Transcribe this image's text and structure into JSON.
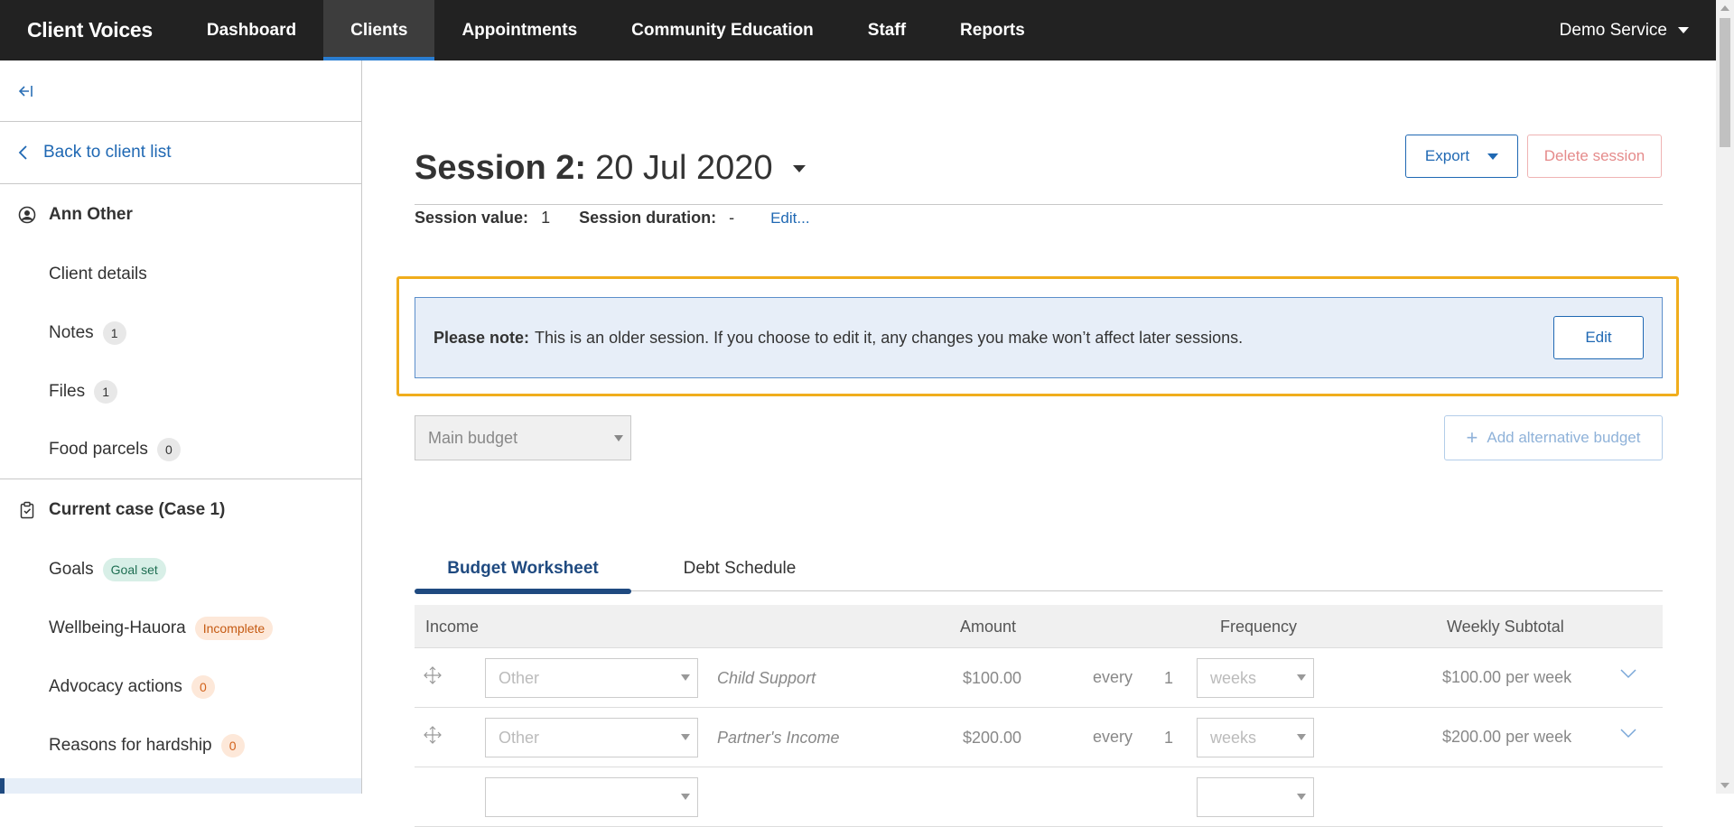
{
  "nav": {
    "brand": "Client Voices",
    "items": [
      {
        "label": "Dashboard"
      },
      {
        "label": "Clients"
      },
      {
        "label": "Appointments"
      },
      {
        "label": "Community Education"
      },
      {
        "label": "Staff"
      },
      {
        "label": "Reports"
      }
    ],
    "active_index": 1,
    "service": "Demo Service"
  },
  "sidebar": {
    "collapse_icon": "collapse-left-icon",
    "back_label": "Back to client list",
    "client_name": "Ann Other",
    "client_items": [
      {
        "label": "Client details"
      },
      {
        "label": "Notes",
        "badge": "1"
      },
      {
        "label": "Files",
        "badge": "1"
      },
      {
        "label": "Food parcels",
        "badge": "0"
      }
    ],
    "case_title": "Current case (Case 1)",
    "case_items": [
      {
        "label": "Goals",
        "badge": "Goal set"
      },
      {
        "label": "Wellbeing-Hauora",
        "badge": "Incomplete"
      },
      {
        "label": "Advocacy actions",
        "badge": "0"
      },
      {
        "label": "Reasons for hardship",
        "badge": "0"
      }
    ]
  },
  "session": {
    "title_bold": "Session 2:",
    "title_date": "20 Jul 2020",
    "export_label": "Export",
    "delete_label": "Delete session",
    "value_label": "Session value:",
    "value": "1",
    "duration_label": "Session duration:",
    "duration": "-",
    "edit_link": "Edit..."
  },
  "note": {
    "prefix": "Please note:",
    "text": "This is an older session. If you choose to edit it, any changes you make won’t affect later sessions.",
    "edit_label": "Edit"
  },
  "budget": {
    "select_value": "Main budget",
    "alt_label": "Add alternative budget"
  },
  "tabs": [
    {
      "label": "Budget Worksheet"
    },
    {
      "label": "Debt Schedule"
    }
  ],
  "table": {
    "headers": {
      "income": "Income",
      "amount": "Amount",
      "frequency": "Frequency",
      "subtotal": "Weekly Subtotal"
    },
    "rows": [
      {
        "type": "Other",
        "desc": "Child Support",
        "amount": "$100.00",
        "every": "every",
        "num": "1",
        "freq": "weeks",
        "subtotal": "$100.00 per week"
      },
      {
        "type": "Other",
        "desc": "Partner's Income",
        "amount": "$200.00",
        "every": "every",
        "num": "1",
        "freq": "weeks",
        "subtotal": "$200.00 per week"
      }
    ]
  },
  "colors": {
    "accent": "#1f68b3",
    "highlight_outline": "#f0ad1c",
    "nav_bg": "#222222"
  }
}
